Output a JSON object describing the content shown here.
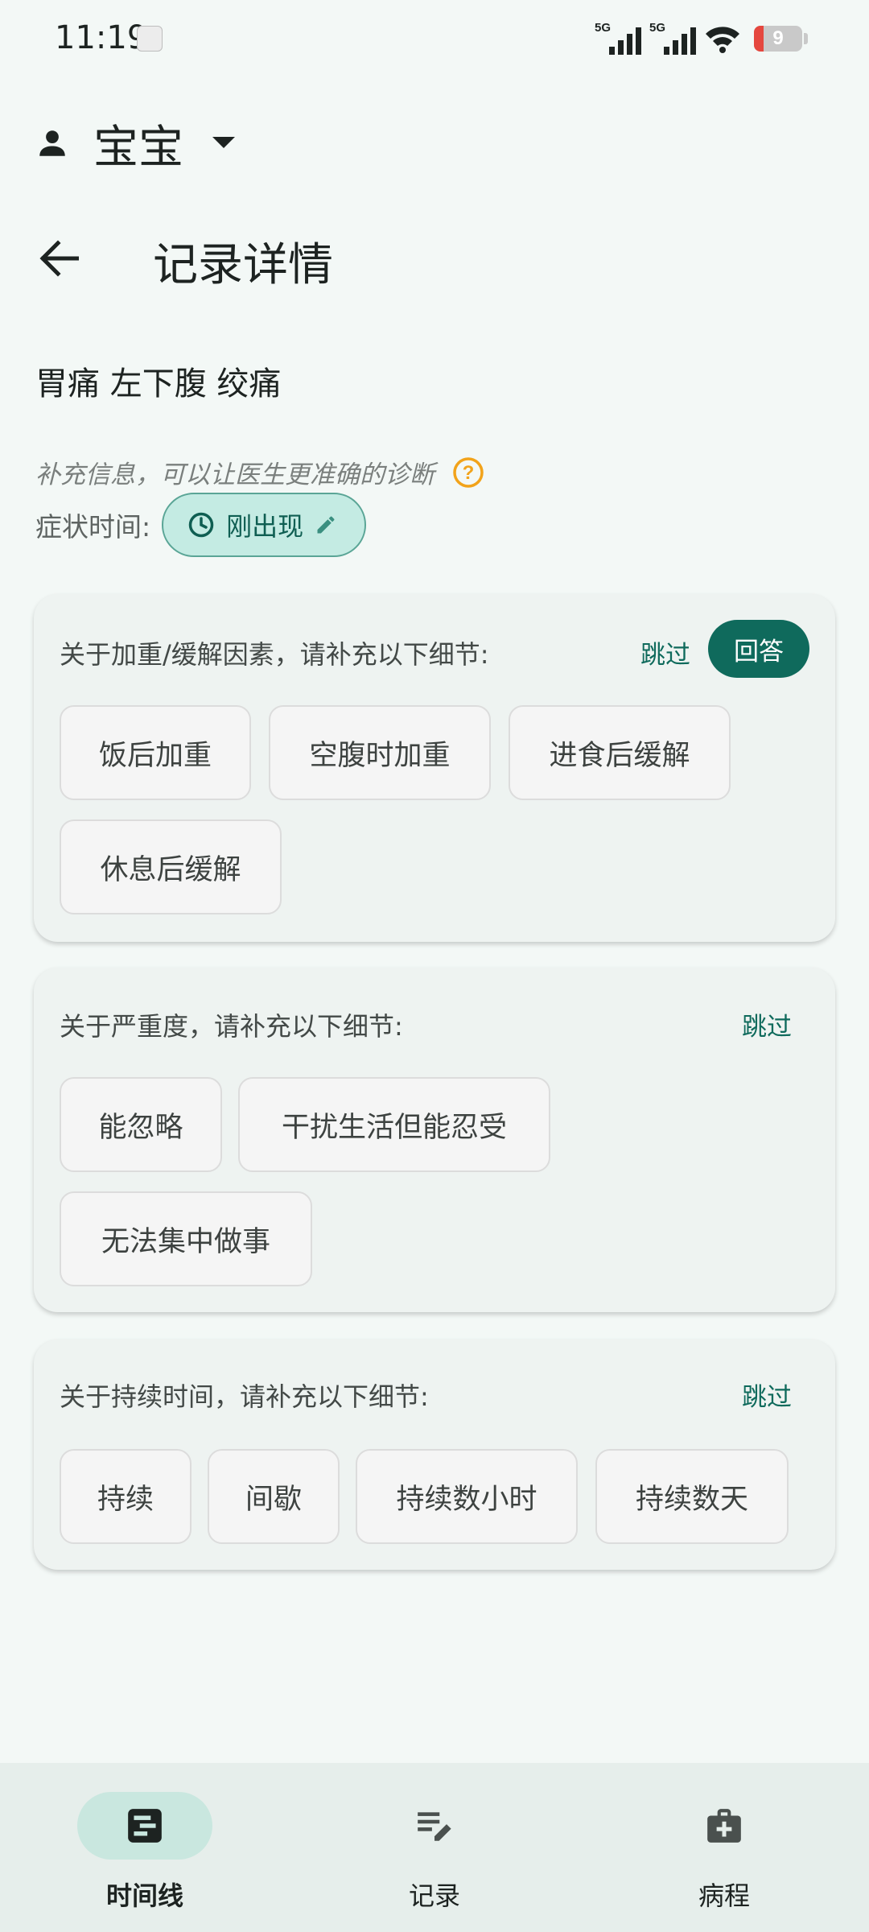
{
  "status_bar": {
    "time": "11:19",
    "signal_1_label": "5G",
    "signal_2_label": "5G",
    "battery_level": "9"
  },
  "profile": {
    "name": "宝宝"
  },
  "header": {
    "title": "记录详情"
  },
  "record": {
    "title": "胃痛 左下腹 绞痛",
    "hint": "补充信息，可以让医生更准确的诊断",
    "time_label": "症状时间:",
    "time_value": "刚出现"
  },
  "cards": [
    {
      "question": "关于加重/缓解因素，请补充以下细节:",
      "skip_label": "跳过",
      "answer_label": "回答",
      "options": [
        "饭后加重",
        "空腹时加重",
        "进食后缓解",
        "休息后缓解"
      ]
    },
    {
      "question": "关于严重度，请补充以下细节:",
      "skip_label": "跳过",
      "options": [
        "能忽略",
        "干扰生活但能忍受",
        "无法集中做事"
      ]
    },
    {
      "question": "关于持续时间，请补充以下细节:",
      "skip_label": "跳过",
      "options": [
        "持续",
        "间歇",
        "持续数小时",
        "持续数天"
      ]
    }
  ],
  "bottom_nav": {
    "items": [
      {
        "label": "时间线",
        "icon": "timeline-icon",
        "active": true
      },
      {
        "label": "记录",
        "icon": "edit-note-icon",
        "active": false
      },
      {
        "label": "病程",
        "icon": "medical-kit-icon",
        "active": false
      }
    ]
  },
  "colors": {
    "accent": "#0f6a5c",
    "chip_bg": "#c4ebe3",
    "background": "#f3f8f6",
    "help_icon": "#f2a31a"
  }
}
